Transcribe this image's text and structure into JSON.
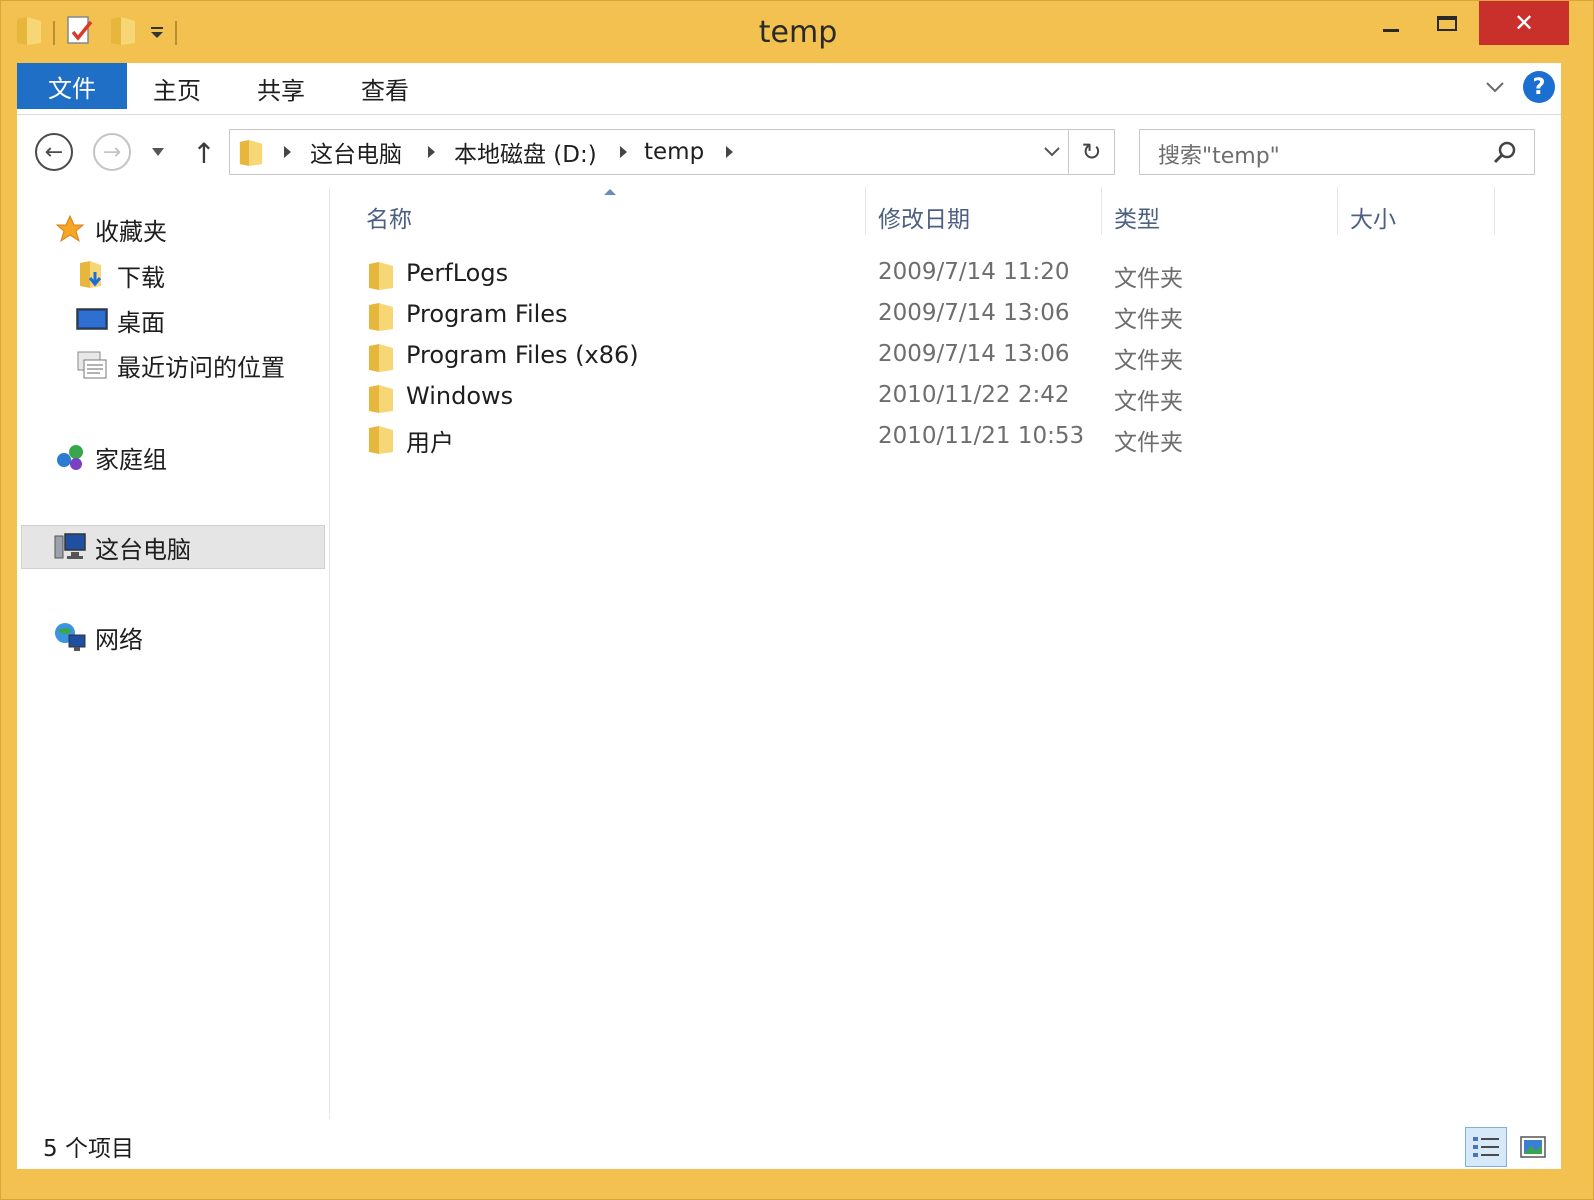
{
  "window": {
    "title": "temp"
  },
  "title_controls": {
    "minimize": "minimize",
    "maximize": "maximize",
    "close": "✕"
  },
  "ribbon": {
    "file_tab": "文件",
    "tabs": [
      "主页",
      "共享",
      "查看"
    ],
    "help": "?"
  },
  "address": {
    "crumbs": [
      "这台电脑",
      "本地磁盘 (D:)",
      "temp"
    ]
  },
  "search": {
    "placeholder": "搜索\"temp\""
  },
  "sidebar": {
    "favorites": "收藏夹",
    "downloads": "下载",
    "desktop": "桌面",
    "recent": "最近访问的位置",
    "homegroup": "家庭组",
    "this_pc": "这台电脑",
    "network": "网络"
  },
  "columns": {
    "name": "名称",
    "date": "修改日期",
    "type": "类型",
    "size": "大小"
  },
  "files": [
    {
      "name": "PerfLogs",
      "date": "2009/7/14 11:20",
      "type": "文件夹"
    },
    {
      "name": "Program Files",
      "date": "2009/7/14 13:06",
      "type": "文件夹"
    },
    {
      "name": "Program Files (x86)",
      "date": "2009/7/14 13:06",
      "type": "文件夹"
    },
    {
      "name": "Windows",
      "date": "2010/11/22 2:42",
      "type": "文件夹"
    },
    {
      "name": "用户",
      "date": "2010/11/21 10:53",
      "type": "文件夹"
    }
  ],
  "status": {
    "item_count": "5 个项目"
  },
  "colors": {
    "frame": "#f3c14f",
    "file_tab": "#1f6fc7",
    "close_button": "#c9302c",
    "folder": "#f2cd5c"
  }
}
